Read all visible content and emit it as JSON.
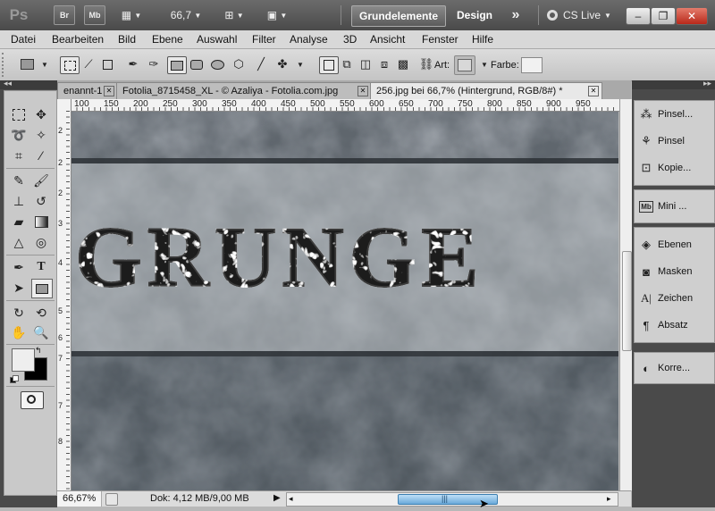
{
  "appbar": {
    "logo": "Ps",
    "bridge": "Br",
    "minibridge": "Mb",
    "zoom": "66,7",
    "workspace_active": "Grundelemente",
    "workspace_design": "Design",
    "more": "»",
    "cslive": "CS Live",
    "win_min": "–",
    "win_restore": "❐",
    "win_close": "✕"
  },
  "menu": [
    "Datei",
    "Bearbeiten",
    "Bild",
    "Ebene",
    "Auswahl",
    "Filter",
    "Analyse",
    "3D",
    "Ansicht",
    "Fenster",
    "Hilfe"
  ],
  "options": {
    "art_label": "Art:",
    "farbe_label": "Farbe:"
  },
  "tabs": [
    {
      "label": "enannt-1"
    },
    {
      "label": "Fotolia_8715458_XL - © Azaliya - Fotolia.com.jpg"
    },
    {
      "label": "256.jpg bei 66,7% (Hintergrund, RGB/8#) *"
    }
  ],
  "ruler_top": [
    "100",
    "150",
    "200",
    "250",
    "300",
    "350",
    "400",
    "450",
    "500",
    "550",
    "600",
    "650",
    "700",
    "750",
    "800",
    "850",
    "900",
    "950"
  ],
  "ruler_left": [
    "2",
    "2",
    "2",
    "3",
    "4",
    "5",
    "6",
    "7",
    "7",
    "8"
  ],
  "canvas_text": "GRUNGE",
  "status": {
    "zoom": "66,67%",
    "doc": "Dok: 4,12 MB/9,00 MB"
  },
  "panels": {
    "group1": [
      "Pinsel...",
      "Pinsel",
      "Kopie..."
    ],
    "group2": [
      "Mini ..."
    ],
    "group3": [
      "Ebenen",
      "Masken",
      "Zeichen",
      "Absatz"
    ],
    "group4": [
      "Korre..."
    ]
  },
  "colors": {
    "foreground": "#eeeeee",
    "background": "#000000",
    "accent_blue": "#6aa9d9"
  }
}
